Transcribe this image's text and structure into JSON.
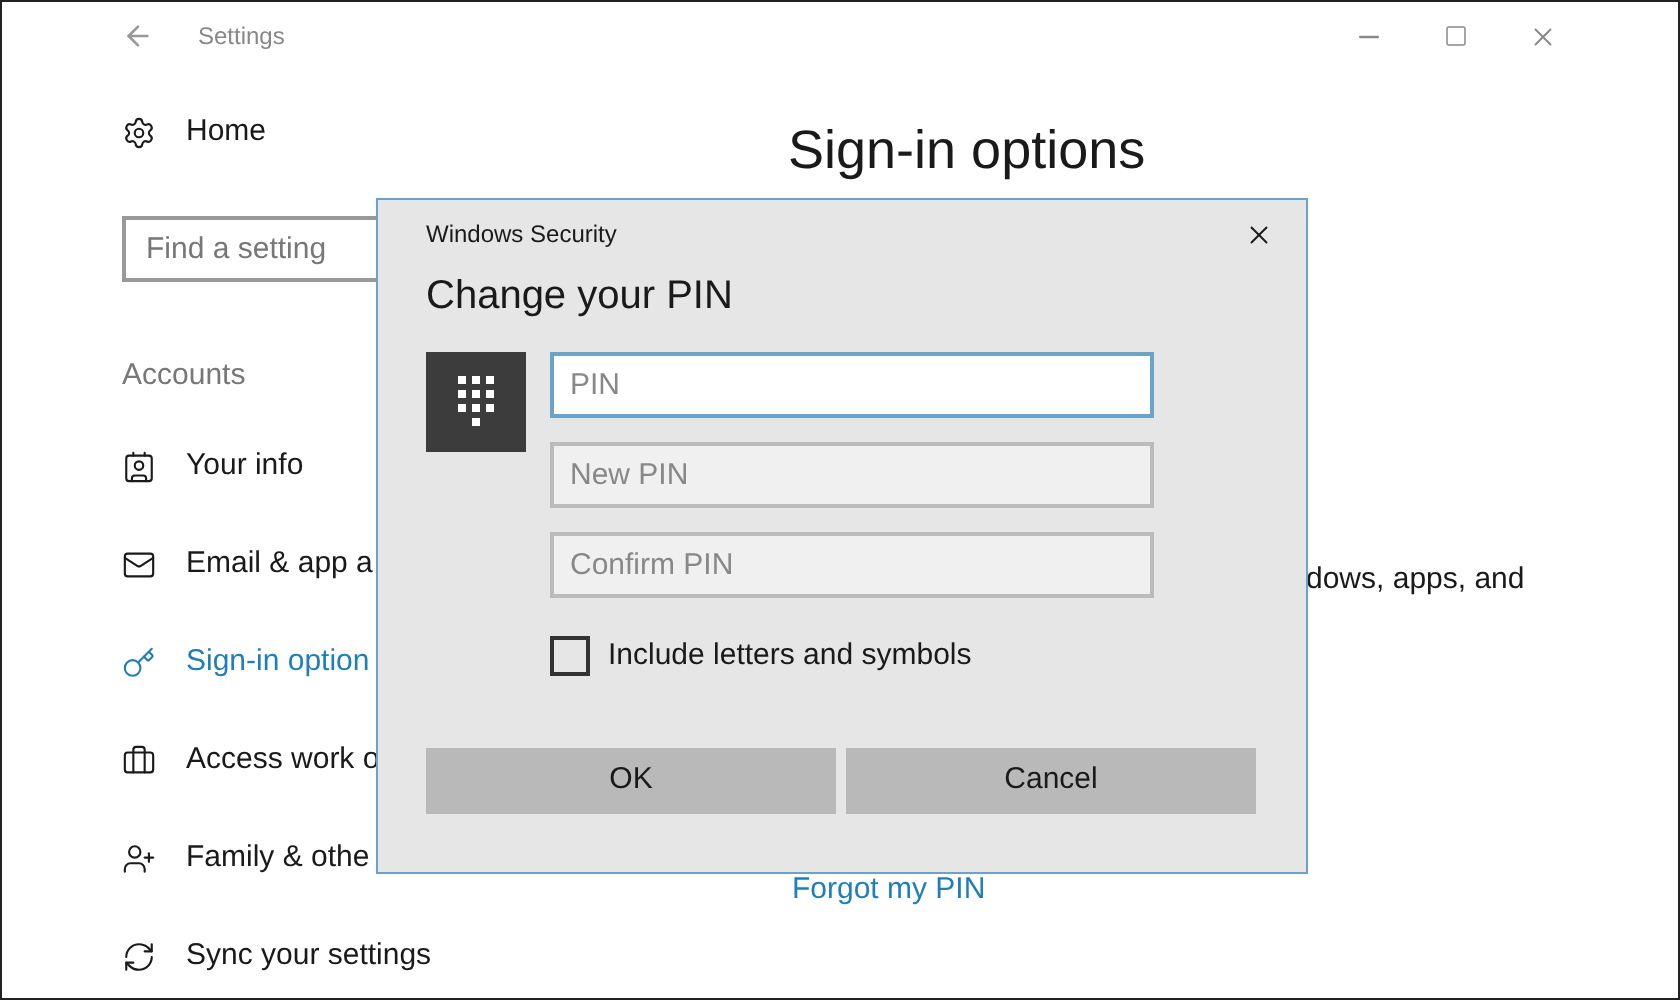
{
  "window": {
    "title": "Settings"
  },
  "sidebar": {
    "home": "Home",
    "search": {
      "placeholder": "Find a setting"
    },
    "section": "Accounts",
    "items": [
      {
        "label": "Your info",
        "selected": false
      },
      {
        "label": "Email & app a",
        "selected": false
      },
      {
        "label": "Sign-in option",
        "selected": true
      },
      {
        "label": "Access work o",
        "selected": false
      },
      {
        "label": "Family & othe",
        "selected": false
      },
      {
        "label": "Sync your settings",
        "selected": false
      }
    ]
  },
  "main": {
    "heading": "Sign-in options",
    "text": "dows, apps, and",
    "link": "Forgot my PIN"
  },
  "dialog": {
    "title": "Windows Security",
    "heading": "Change your PIN",
    "fields": [
      {
        "placeholder": "PIN",
        "focused": true
      },
      {
        "placeholder": "New PIN",
        "focused": false
      },
      {
        "placeholder": "Confirm PIN",
        "focused": false
      }
    ],
    "checkbox": {
      "label": "Include letters and symbols",
      "checked": false
    },
    "buttons": [
      "OK",
      "Cancel"
    ]
  }
}
